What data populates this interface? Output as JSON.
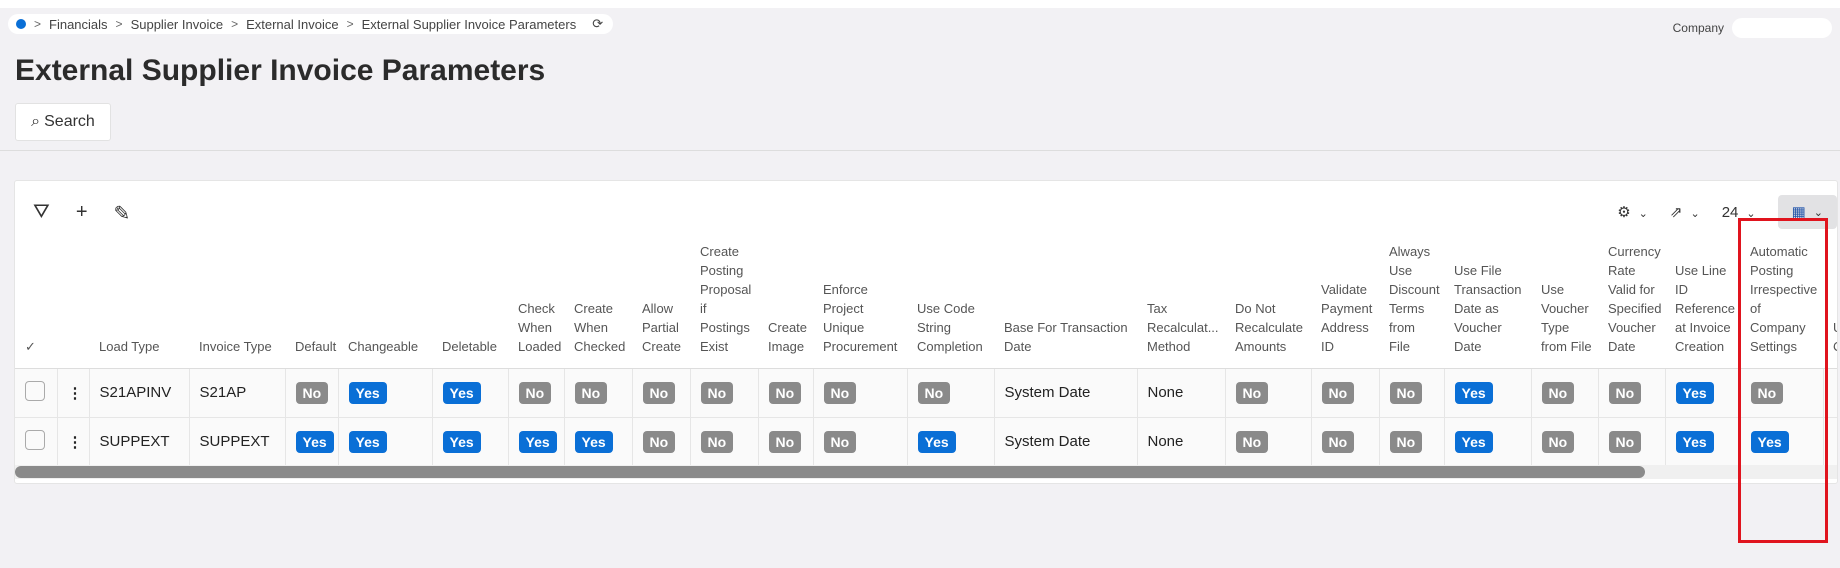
{
  "breadcrumb": [
    "Financials",
    "Supplier Invoice",
    "External Invoice",
    "External Supplier Invoice Parameters"
  ],
  "company_label": "Company",
  "page_title": "External Supplier Invoice Parameters",
  "search_label": "Search",
  "page_size": "24",
  "colors": {
    "yes": "#0a6fd6",
    "no": "#8a8a8a",
    "highlight": "#e0141e"
  },
  "columns": [
    {
      "label": "Load Type",
      "w": 100,
      "type": "text"
    },
    {
      "label": "Invoice Type",
      "w": 96,
      "type": "text"
    },
    {
      "label": "Default",
      "w": 53
    },
    {
      "label": "Changeable",
      "w": 94
    },
    {
      "label": "Deletable",
      "w": 76
    },
    {
      "label": "Check When Loaded",
      "w": 56
    },
    {
      "label": "Create When Checked",
      "w": 68
    },
    {
      "label": "Allow Partial Create",
      "w": 58
    },
    {
      "label": "Create Posting Proposal if Postings Exist",
      "w": 68
    },
    {
      "label": "Create Image",
      "w": 55
    },
    {
      "label": "Enforce Project Unique Procurement",
      "w": 94
    },
    {
      "label": "Use Code String Completion",
      "w": 87
    },
    {
      "label": "Base For Transaction Date",
      "w": 143,
      "type": "text"
    },
    {
      "label": "Tax Recalculat... Method",
      "w": 88,
      "type": "text"
    },
    {
      "label": "Do Not Recalculate Amounts",
      "w": 86
    },
    {
      "label": "Validate Payment Address ID",
      "w": 68
    },
    {
      "label": "Always Use Discount Terms from File",
      "w": 65
    },
    {
      "label": "Use File Transaction Date as Voucher Date",
      "w": 87
    },
    {
      "label": "Use Voucher Type from File",
      "w": 67
    },
    {
      "label": "Currency Rate Valid for Specified Voucher Date",
      "w": 67
    },
    {
      "label": "Use Line ID Reference at Invoice Creation",
      "w": 75
    },
    {
      "label": "Automatic Posting Irrespective of Company Settings",
      "w": 83
    },
    {
      "label": "U D C C",
      "w": 60
    }
  ],
  "rows": [
    [
      "S21APINV",
      "S21AP",
      "No",
      "Yes",
      "Yes",
      "No",
      "No",
      "No",
      "No",
      "No",
      "No",
      "No",
      "System Date",
      "None",
      "No",
      "No",
      "No",
      "Yes",
      "No",
      "No",
      "Yes",
      "No",
      ""
    ],
    [
      "SUPPEXT",
      "SUPPEXT",
      "Yes",
      "Yes",
      "Yes",
      "Yes",
      "Yes",
      "No",
      "No",
      "No",
      "No",
      "Yes",
      "System Date",
      "None",
      "No",
      "No",
      "No",
      "Yes",
      "No",
      "No",
      "Yes",
      "Yes",
      ""
    ]
  ]
}
